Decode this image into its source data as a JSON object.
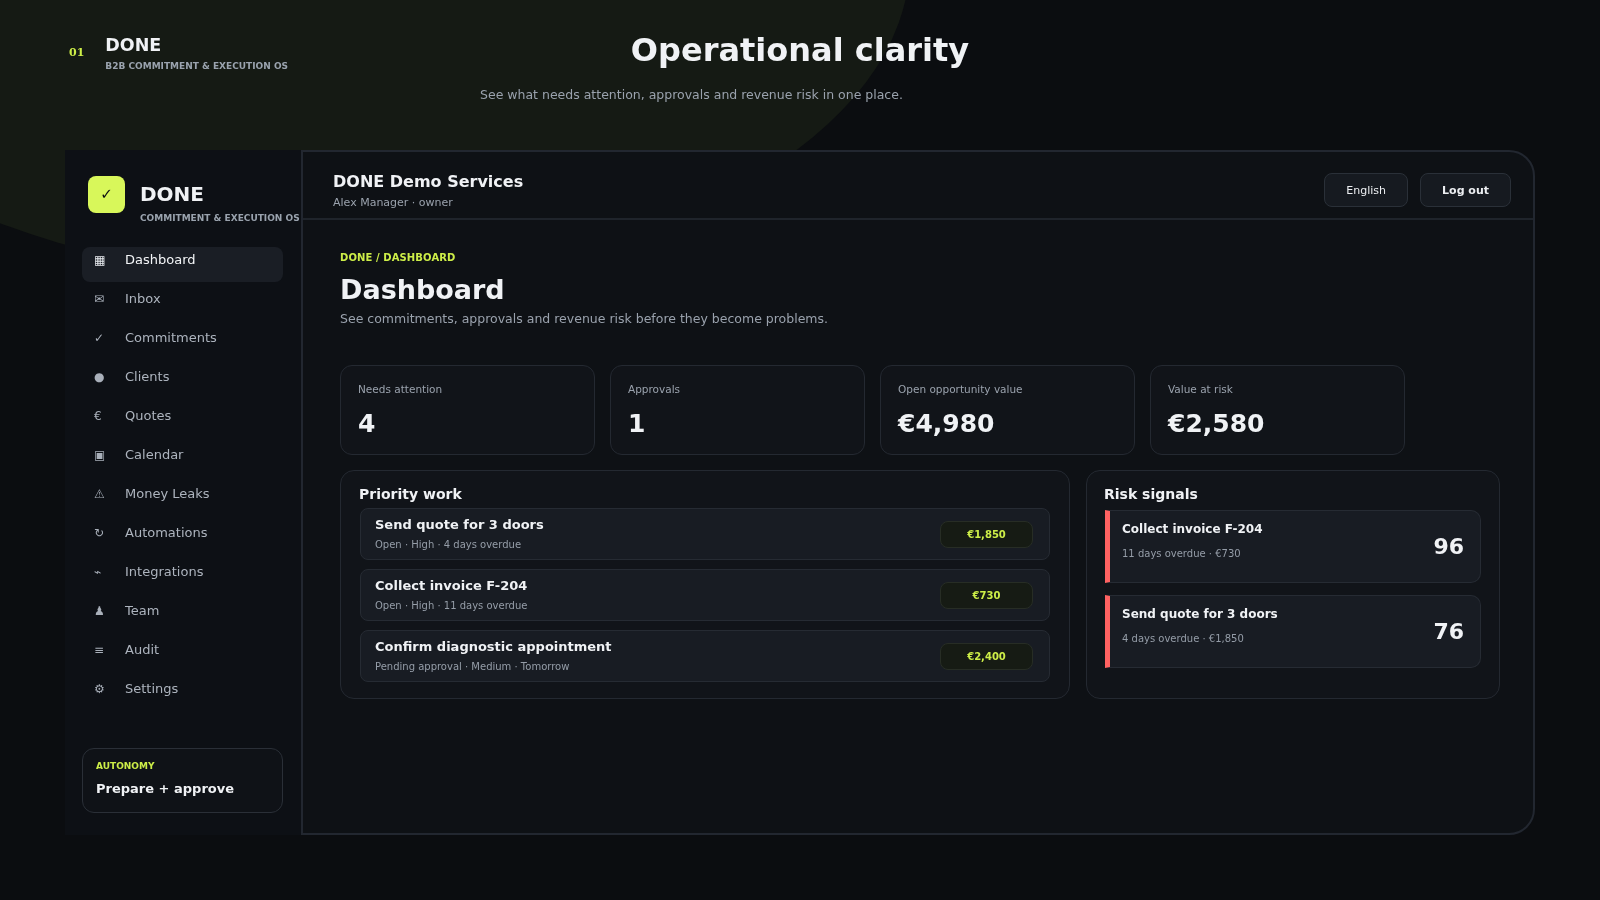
{
  "header": {
    "step": "01",
    "brand": "DONE",
    "tagline": "B2B COMMITMENT & EXECUTION OS",
    "title": "Operational clarity",
    "subtitle": "See what needs attention, approvals and revenue risk in one place."
  },
  "sidebar": {
    "logo": "✓",
    "app_name": "DONE",
    "app_tagline": "COMMITMENT & EXECUTION OS",
    "items": [
      {
        "icon": "▦",
        "label": "Dashboard",
        "selected": true
      },
      {
        "icon": "✉",
        "label": "Inbox",
        "selected": false
      },
      {
        "icon": "✓",
        "label": "Commitments",
        "selected": false
      },
      {
        "icon": "●",
        "label": "Clients",
        "selected": false
      },
      {
        "icon": "€",
        "label": "Quotes",
        "selected": false
      },
      {
        "icon": "▣",
        "label": "Calendar",
        "selected": false
      },
      {
        "icon": "⚠",
        "label": "Money Leaks",
        "selected": false
      },
      {
        "icon": "↻",
        "label": "Automations",
        "selected": false
      },
      {
        "icon": "⌁",
        "label": "Integrations",
        "selected": false
      },
      {
        "icon": "♟",
        "label": "Team",
        "selected": false
      },
      {
        "icon": "≡",
        "label": "Audit",
        "selected": false
      },
      {
        "icon": "⚙",
        "label": "Settings",
        "selected": false
      }
    ],
    "autonomy": {
      "label": "AUTONOMY",
      "value": "Prepare + approve"
    }
  },
  "topbar": {
    "company": "DONE Demo Services",
    "user": "Alex Manager · owner",
    "buttons": [
      {
        "kind": "language",
        "label": "English"
      },
      {
        "kind": "logout",
        "label": "Log out"
      }
    ]
  },
  "page": {
    "breadcrumb": "DONE / DASHBOARD",
    "title": "Dashboard",
    "description": "See commitments, approvals and revenue risk before they become problems."
  },
  "stats": [
    {
      "label": "Needs attention",
      "value": "4"
    },
    {
      "label": "Approvals",
      "value": "1"
    },
    {
      "label": "Open opportunity value",
      "value": "€4,980"
    },
    {
      "label": "Value at risk",
      "value": "€2,580"
    }
  ],
  "priority_work": {
    "title": "Priority work",
    "items": [
      {
        "title": "Send quote for 3 doors",
        "meta": "Open · High · 4 days overdue",
        "amount": "€1,850"
      },
      {
        "title": "Collect invoice F-204",
        "meta": "Open · High · 11 days overdue",
        "amount": "€730"
      },
      {
        "title": "Confirm diagnostic appointment",
        "meta": "Pending approval · Medium · Tomorrow",
        "amount": "€2,400"
      }
    ]
  },
  "risk_signals": {
    "title": "Risk signals",
    "items": [
      {
        "title": "Collect invoice F-204",
        "meta": "11 days overdue · €730",
        "score": "96"
      },
      {
        "title": "Send quote for 3 doors",
        "meta": "4 days overdue · €1,850",
        "score": "76"
      }
    ]
  }
}
